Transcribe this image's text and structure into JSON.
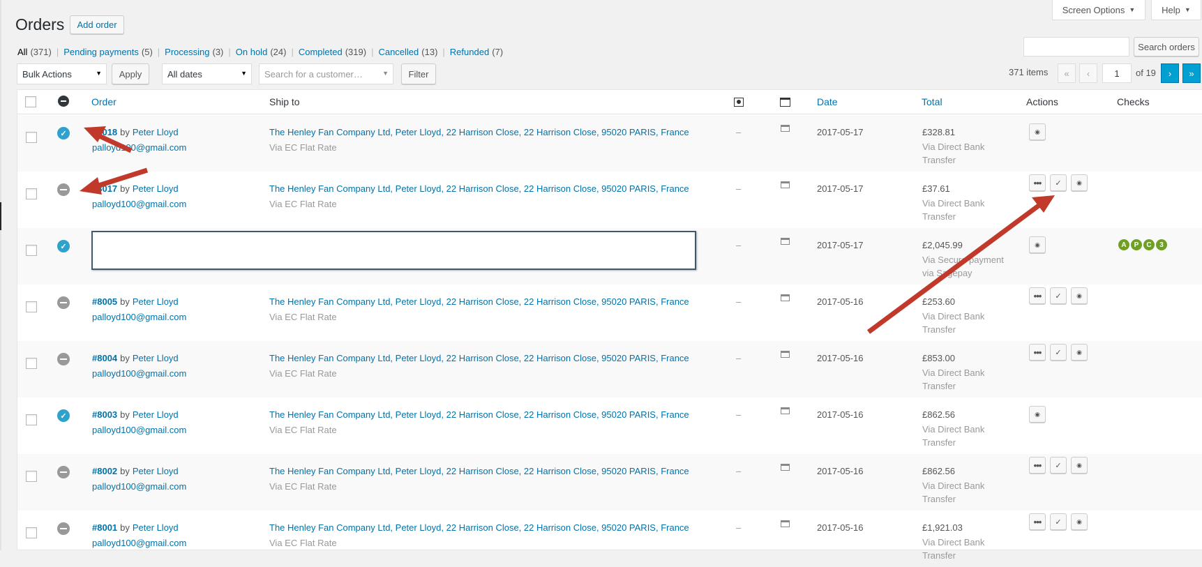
{
  "header": {
    "title": "Orders",
    "add_order": "Add order",
    "screen_options": "Screen Options",
    "help": "Help",
    "search_placeholder": "",
    "search_button": "Search orders"
  },
  "filters": {
    "views": [
      {
        "label": "All",
        "count": "(371)"
      },
      {
        "label": "Pending payments",
        "count": "(5)"
      },
      {
        "label": "Processing",
        "count": "(3)"
      },
      {
        "label": "On hold",
        "count": "(24)"
      },
      {
        "label": "Completed",
        "count": "(319)"
      },
      {
        "label": "Cancelled",
        "count": "(13)"
      },
      {
        "label": "Refunded",
        "count": "(7)"
      }
    ],
    "bulk_actions": "Bulk Actions",
    "apply": "Apply",
    "all_dates": "All dates",
    "customer_placeholder": "Search for a customer…",
    "filter": "Filter"
  },
  "pagination": {
    "items": "371 items",
    "first": "«",
    "prev": "‹",
    "current": "1",
    "of": "of 19",
    "next": "›",
    "last": "»"
  },
  "columns": {
    "order": "Order",
    "ship_to": "Ship to",
    "date": "Date",
    "total": "Total",
    "actions": "Actions",
    "checks": "Checks"
  },
  "rows": [
    {
      "status": "completed",
      "number": "#8018",
      "by": "by",
      "customer": "Peter Lloyd",
      "email": "palloyd100@gmail.com",
      "ship": "The Henley Fan Company Ltd, Peter Lloyd, 22 Harrison Close, 22 Harrison Close, 95020 PARIS, France",
      "ship_method": "Via EC Flat Rate",
      "purchased": "–",
      "date": "2017-05-17",
      "total": "£328.81",
      "payment": "Via Direct Bank Transfer",
      "actions": [
        "view"
      ]
    },
    {
      "status": "on-hold",
      "number": "#8017",
      "by": "by",
      "customer": "Peter Lloyd",
      "email": "palloyd100@gmail.com",
      "ship": "The Henley Fan Company Ltd, Peter Lloyd, 22 Harrison Close, 22 Harrison Close, 95020 PARIS, France",
      "ship_method": "Via EC Flat Rate",
      "purchased": "–",
      "date": "2017-05-17",
      "total": "£37.61",
      "payment": "Via Direct Bank Transfer",
      "actions": [
        "processing",
        "complete",
        "view"
      ]
    },
    {
      "status": "completed",
      "number": "",
      "by": "",
      "customer": "",
      "email": "",
      "ship": "",
      "ship_method": "",
      "purchased": "–",
      "date": "2017-05-17",
      "total": "£2,045.99",
      "payment": "Via Secure payment via Sagepay",
      "actions": [
        "view"
      ],
      "checks": [
        "A",
        "P",
        "C",
        "3"
      ]
    },
    {
      "status": "on-hold",
      "number": "#8005",
      "by": "by",
      "customer": "Peter Lloyd",
      "email": "palloyd100@gmail.com",
      "ship": "The Henley Fan Company Ltd, Peter Lloyd, 22 Harrison Close, 22 Harrison Close, 95020 PARIS, France",
      "ship_method": "Via EC Flat Rate",
      "purchased": "–",
      "date": "2017-05-16",
      "total": "£253.60",
      "payment": "Via Direct Bank Transfer",
      "actions": [
        "processing",
        "complete",
        "view"
      ]
    },
    {
      "status": "on-hold",
      "number": "#8004",
      "by": "by",
      "customer": "Peter Lloyd",
      "email": "palloyd100@gmail.com",
      "ship": "The Henley Fan Company Ltd, Peter Lloyd, 22 Harrison Close, 22 Harrison Close, 95020 PARIS, France",
      "ship_method": "Via EC Flat Rate",
      "purchased": "–",
      "date": "2017-05-16",
      "total": "£853.00",
      "payment": "Via Direct Bank Transfer",
      "actions": [
        "processing",
        "complete",
        "view"
      ]
    },
    {
      "status": "completed",
      "number": "#8003",
      "by": "by",
      "customer": "Peter Lloyd",
      "email": "palloyd100@gmail.com",
      "ship": "The Henley Fan Company Ltd, Peter Lloyd, 22 Harrison Close, 22 Harrison Close, 95020 PARIS, France",
      "ship_method": "Via EC Flat Rate",
      "purchased": "–",
      "date": "2017-05-16",
      "total": "£862.56",
      "payment": "Via Direct Bank Transfer",
      "actions": [
        "view"
      ]
    },
    {
      "status": "on-hold",
      "number": "#8002",
      "by": "by",
      "customer": "Peter Lloyd",
      "email": "palloyd100@gmail.com",
      "ship": "The Henley Fan Company Ltd, Peter Lloyd, 22 Harrison Close, 22 Harrison Close, 95020 PARIS, France",
      "ship_method": "Via EC Flat Rate",
      "purchased": "–",
      "date": "2017-05-16",
      "total": "£862.56",
      "payment": "Via Direct Bank Transfer",
      "actions": [
        "processing",
        "complete",
        "view"
      ]
    },
    {
      "status": "on-hold",
      "number": "#8001",
      "by": "by",
      "customer": "Peter Lloyd",
      "email": "palloyd100@gmail.com",
      "ship": "The Henley Fan Company Ltd, Peter Lloyd, 22 Harrison Close, 22 Harrison Close, 95020 PARIS, France",
      "ship_method": "Via EC Flat Rate",
      "purchased": "–",
      "date": "2017-05-16",
      "total": "£1,921.03",
      "payment": "Via Direct Bank Transfer",
      "actions": [
        "processing",
        "complete",
        "view"
      ]
    }
  ],
  "icons": {
    "completed": "check-circle-icon",
    "on-hold": "minus-circle-icon",
    "processing": "ellipsis-icon",
    "complete": "checkmark-icon",
    "view": "eye-icon"
  },
  "colors": {
    "link": "#0073aa",
    "completed_status": "#2ea2cc",
    "on_hold_status": "#999999",
    "check_badge": "#6f9f25",
    "annotation_arrow": "#c0392b"
  }
}
